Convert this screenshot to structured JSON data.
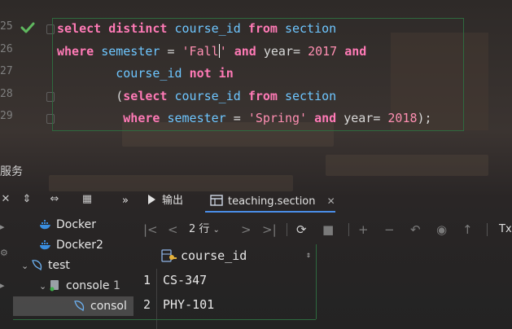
{
  "editor": {
    "line_numbers": [
      "25",
      "26",
      "27",
      "28",
      "29"
    ],
    "lines": [
      [
        {
          "t": "select distinct ",
          "c": "kw"
        },
        {
          "t": "course_id ",
          "c": "ident"
        },
        {
          "t": "from ",
          "c": "kw"
        },
        {
          "t": "section",
          "c": "ident"
        }
      ],
      [
        {
          "t": "where ",
          "c": "kw"
        },
        {
          "t": "semester ",
          "c": "ident"
        },
        {
          "t": "= ",
          "c": "plain"
        },
        {
          "t": "'Fall",
          "c": "str"
        },
        {
          "t": "|caret|",
          "c": "caret"
        },
        {
          "t": "' ",
          "c": "str"
        },
        {
          "t": "and ",
          "c": "kw"
        },
        {
          "t": "year= ",
          "c": "plain"
        },
        {
          "t": "2017 ",
          "c": "num"
        },
        {
          "t": "and",
          "c": "kw"
        }
      ],
      [
        {
          "t": "        course_id ",
          "c": "ident"
        },
        {
          "t": "not in",
          "c": "kw"
        }
      ],
      [
        {
          "t": "        (",
          "c": "plain"
        },
        {
          "t": "select ",
          "c": "kw"
        },
        {
          "t": "course_id ",
          "c": "ident"
        },
        {
          "t": "from ",
          "c": "kw"
        },
        {
          "t": "section",
          "c": "ident"
        }
      ],
      [
        {
          "t": "         where ",
          "c": "kw"
        },
        {
          "t": "semester ",
          "c": "ident"
        },
        {
          "t": "= ",
          "c": "plain"
        },
        {
          "t": "'Spring' ",
          "c": "str"
        },
        {
          "t": "and ",
          "c": "kw"
        },
        {
          "t": "year= ",
          "c": "plain"
        },
        {
          "t": "2018",
          "c": "num"
        },
        {
          "t": ");",
          "c": "plain"
        }
      ]
    ]
  },
  "services": {
    "title": "服务",
    "tabs": {
      "more": "»",
      "output_label": "输出",
      "table_tab_label": "teaching.section",
      "close": "✕"
    },
    "tree": {
      "docker": "Docker",
      "docker2": "Docker2",
      "test": "test",
      "console": "console",
      "console_suffix": "1",
      "console_child": "consol"
    },
    "data_toolbar": {
      "rows_label": "2 行",
      "tx_label": "Tx"
    },
    "grid": {
      "columns": [
        "course_id"
      ],
      "rows": [
        {
          "num": "1",
          "course_id": "CS-347"
        },
        {
          "num": "2",
          "course_id": "PHY-101"
        }
      ]
    }
  },
  "colors": {
    "keyword": "#ff7ab6",
    "identifier": "#6ec6ff",
    "string": "#ff8fb2",
    "accent": "#4a8ee8",
    "frame_green": "#2e6a3f",
    "check_green": "#5fb85f"
  }
}
